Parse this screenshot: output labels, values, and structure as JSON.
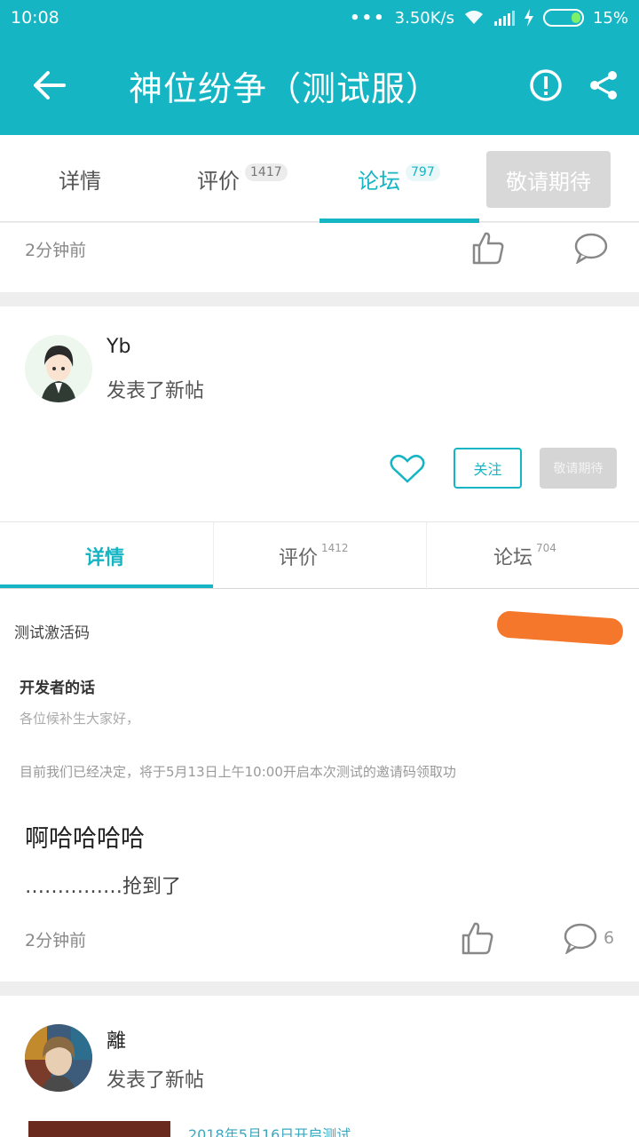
{
  "status_bar": {
    "time": "10:08",
    "network_speed": "3.50K/s",
    "battery": "15%"
  },
  "app_bar": {
    "title": "神位纷争（测试服）",
    "back_icon": "arrow-left-icon",
    "report_icon": "alert-circle-icon",
    "share_icon": "share-icon"
  },
  "top_tabs": {
    "items": [
      {
        "label": "详情",
        "badge": ""
      },
      {
        "label": "评价",
        "badge": "1417"
      },
      {
        "label": "论坛",
        "badge": "797"
      }
    ],
    "active_index": 2,
    "action_button": "敬请期待"
  },
  "first_card": {
    "time": "2分钟前"
  },
  "post": {
    "author": "Yb",
    "action": "发表了新帖",
    "embedded": {
      "follow_label": "关注",
      "wait_label": "敬请期待",
      "subtabs": [
        {
          "label": "详情",
          "badge": ""
        },
        {
          "label": "评价",
          "badge": "1412"
        },
        {
          "label": "论坛",
          "badge": "704"
        }
      ],
      "code_label": "测试激活码",
      "dev_title": "开发者的话",
      "dev_greeting": "各位候补生大家好，",
      "dev_text": "目前我们已经决定，将于5月13日上午10:00开启本次测试的邀请码领取功"
    },
    "title": "啊哈哈哈哈",
    "body": "……………抢到了",
    "time": "2分钟前",
    "comment_count": "6"
  },
  "next_post": {
    "author": "離",
    "action": "发表了新帖",
    "preview_text": "2018年5月16日开启测试"
  },
  "colors": {
    "primary": "#16b5c4",
    "background": "#eeeeee",
    "redaction": "#f4772b"
  }
}
